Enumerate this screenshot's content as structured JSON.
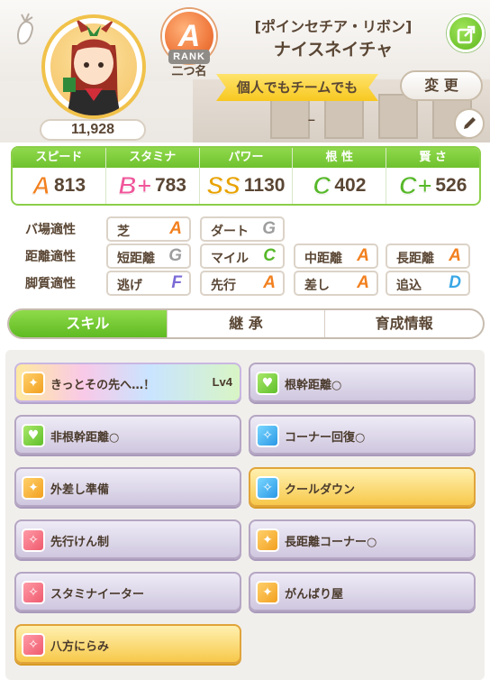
{
  "header": {
    "epithet": "[ポインセチア・リボン]",
    "character_name": "ナイスネイチャ",
    "fans": "11,928",
    "rank_letter": "A",
    "rank_label": "RANK",
    "rank_name": "二つ名",
    "motto": "個人でもチームでも",
    "change_label": "変 更",
    "dash": "–"
  },
  "stats": [
    {
      "label": "スピード",
      "icon": "shoe-icon",
      "grade": "A",
      "value": "813",
      "color": "#f2801f"
    },
    {
      "label": "スタミナ",
      "icon": "heart-icon",
      "grade": "B+",
      "value": "783",
      "color": "#f0569a"
    },
    {
      "label": "パワー",
      "icon": "muscle-icon",
      "grade": "SS",
      "value": "1130",
      "color": "#e8a200"
    },
    {
      "label": "根 性",
      "icon": "flame-icon",
      "grade": "C",
      "value": "402",
      "color": "#57b82a"
    },
    {
      "label": "賢 さ",
      "icon": "graduation-cap-icon",
      "grade": "C+",
      "value": "526",
      "color": "#57b82a"
    }
  ],
  "aptitudes": [
    {
      "label": "バ場適性",
      "items": [
        {
          "name": "芝",
          "grade": "A"
        },
        {
          "name": "ダート",
          "grade": "G"
        }
      ]
    },
    {
      "label": "距離適性",
      "items": [
        {
          "name": "短距離",
          "grade": "G"
        },
        {
          "name": "マイル",
          "grade": "C"
        },
        {
          "name": "中距離",
          "grade": "A"
        },
        {
          "name": "長距離",
          "grade": "A"
        }
      ]
    },
    {
      "label": "脚質適性",
      "items": [
        {
          "name": "逃げ",
          "grade": "F"
        },
        {
          "name": "先行",
          "grade": "A"
        },
        {
          "name": "差し",
          "grade": "A"
        },
        {
          "name": "追込",
          "grade": "D"
        }
      ]
    }
  ],
  "grade_colors": {
    "A": "#f2801f",
    "C": "#57b82a",
    "D": "#3aa7e6",
    "F": "#7b6bd6",
    "G": "#9e9e9e"
  },
  "tabs": [
    "スキル",
    "継 承",
    "育成情報"
  ],
  "skills": [
    {
      "name": "きっとその先へ…！",
      "level": "Lv4",
      "style": "rainbow",
      "icon": "speed"
    },
    {
      "name": "根幹距離○",
      "level": "",
      "style": "normal",
      "icon": "stam"
    },
    {
      "name": "非根幹距離○",
      "level": "",
      "style": "normal",
      "icon": "stam"
    },
    {
      "name": "コーナー回復○",
      "level": "",
      "style": "normal",
      "icon": "heal"
    },
    {
      "name": "外差し準備",
      "level": "",
      "style": "normal",
      "icon": "speed"
    },
    {
      "name": "クールダウン",
      "level": "",
      "style": "gold",
      "icon": "heal"
    },
    {
      "name": "先行けん制",
      "level": "",
      "style": "normal",
      "icon": "debuff"
    },
    {
      "name": "長距離コーナー○",
      "level": "",
      "style": "normal",
      "icon": "speed"
    },
    {
      "name": "スタミナイーター",
      "level": "",
      "style": "normal",
      "icon": "debuff"
    },
    {
      "name": "がんばり屋",
      "level": "",
      "style": "normal",
      "icon": "speed"
    },
    {
      "name": "八方にらみ",
      "level": "",
      "style": "gold",
      "icon": "debuff"
    }
  ]
}
